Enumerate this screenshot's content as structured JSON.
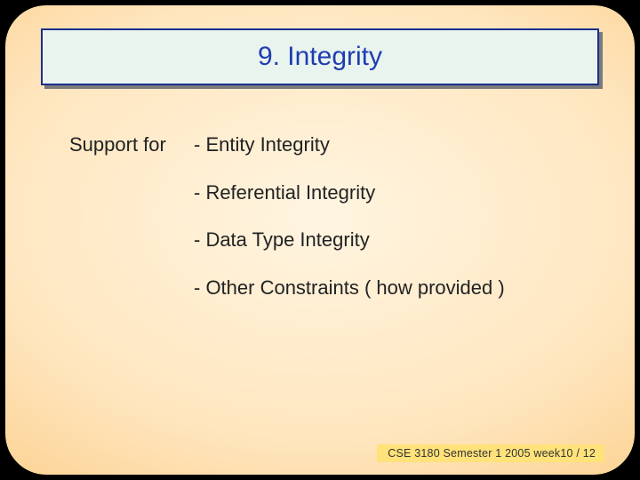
{
  "title": "9. Integrity",
  "label": "Support for",
  "items": [
    "-  Entity Integrity",
    "-  Referential Integrity",
    "-  Data Type Integrity",
    "-  Other Constraints ( how provided )"
  ],
  "footer": "CSE 3180 Semester 1 2005  week10 / 12"
}
